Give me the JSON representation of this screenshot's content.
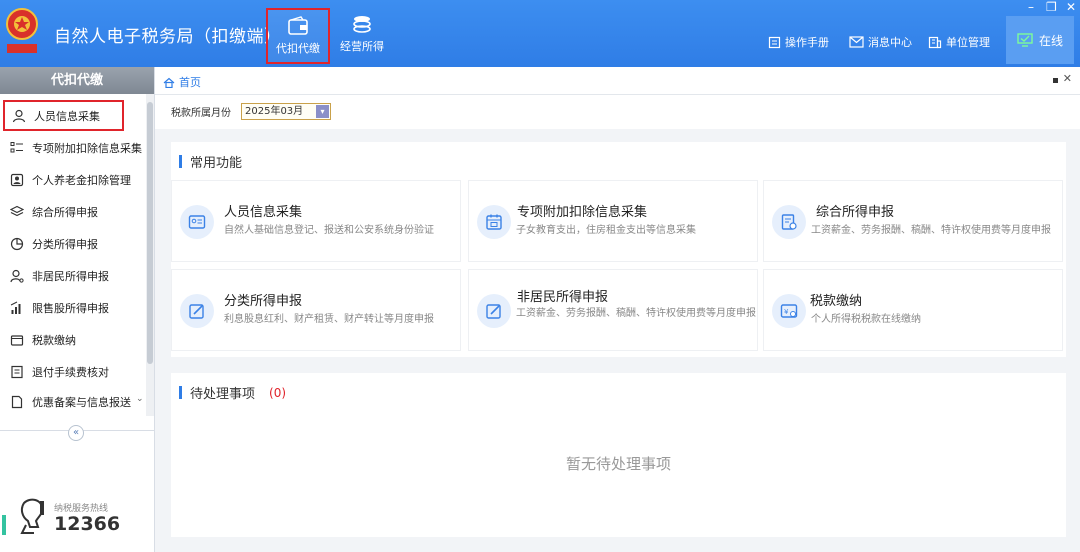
{
  "app": {
    "title": "自然人电子税务局（扣缴端）",
    "emblem_text": "中国税务"
  },
  "top_tabs": [
    {
      "label": "代扣代缴",
      "icon": "wallet-icon",
      "active": true
    },
    {
      "label": "经营所得",
      "icon": "coins-icon",
      "active": false
    }
  ],
  "header_links": [
    {
      "label": "操作手册",
      "icon": "manual-icon"
    },
    {
      "label": "消息中心",
      "icon": "mail-icon"
    },
    {
      "label": "单位管理",
      "icon": "building-icon"
    }
  ],
  "online_button": {
    "label": "在线",
    "icon": "monitor-icon"
  },
  "window_controls": {
    "minimize": "–",
    "restore": "❐",
    "close": "✕"
  },
  "sidebar": {
    "header": "代扣代缴",
    "items": [
      {
        "label": "人员信息采集",
        "icon": "person-icon",
        "selected": true
      },
      {
        "label": "专项附加扣除信息采集",
        "icon": "list-icon",
        "selected": false
      },
      {
        "label": "个人养老金扣除管理",
        "icon": "pension-icon",
        "selected": false
      },
      {
        "label": "综合所得申报",
        "icon": "layers-icon",
        "selected": false
      },
      {
        "label": "分类所得申报",
        "icon": "pie-icon",
        "selected": false
      },
      {
        "label": "非居民所得申报",
        "icon": "person-globe-icon",
        "selected": false
      },
      {
        "label": "限售股所得申报",
        "icon": "bar-chart-icon",
        "selected": false
      },
      {
        "label": "税款缴纳",
        "icon": "wallet-icon",
        "selected": false
      },
      {
        "label": "退付手续费核对",
        "icon": "receipt-icon",
        "selected": false
      },
      {
        "label": "优惠备案与信息报送",
        "icon": "document-icon",
        "selected": false
      }
    ],
    "collapse_glyph": "«",
    "hotline_label": "纳税服务热线",
    "hotline_number": "12366"
  },
  "breadcrumb": {
    "home": "首页"
  },
  "tax_month": {
    "label": "税款所属月份",
    "value": "2025年03月"
  },
  "common_functions": {
    "title": "常用功能",
    "cards": [
      {
        "title": "人员信息采集",
        "desc": "自然人基础信息登记、报送和公安系统身份验证",
        "icon": "id-card-icon"
      },
      {
        "title": "专项附加扣除信息采集",
        "desc": "子女教育支出，住房租金支出等信息采集",
        "icon": "calendar-icon"
      },
      {
        "title": "综合所得申报",
        "desc": "工资薪金、劳务报酬、稿酬、特许权使用费等月度申报",
        "icon": "form-icon"
      },
      {
        "title": "分类所得申报",
        "desc": "利息股息红利、财产租赁、财产转让等月度申报",
        "icon": "edit-icon"
      },
      {
        "title": "非居民所得申报",
        "desc": "工资薪金、劳务报酬、稿酬、特许权使用费等月度申报",
        "icon": "edit-icon"
      },
      {
        "title": "税款缴纳",
        "desc": "个人所得税税款在线缴纳",
        "icon": "tax-pay-icon"
      }
    ]
  },
  "pending": {
    "title": "待处理事项",
    "count": "(0)",
    "empty_text": "暂无待处理事项"
  },
  "colors": {
    "header_blue": "#2f7de6",
    "highlight_red": "#e0242b",
    "accent_green": "#34c3a0"
  }
}
